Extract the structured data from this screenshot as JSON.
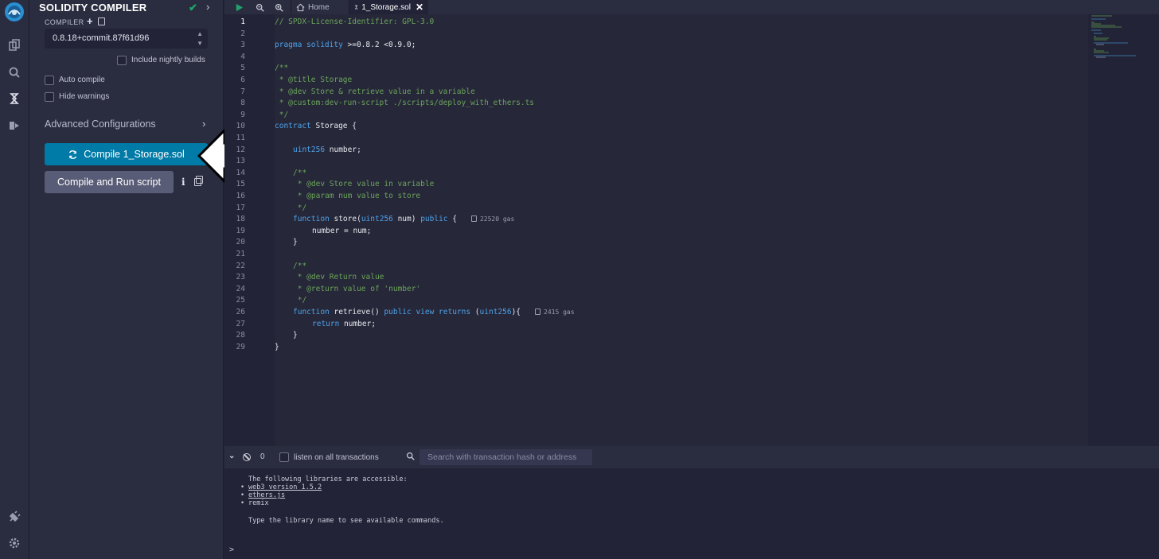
{
  "panel": {
    "title": "SOLIDITY COMPILER",
    "compiler_label": "COMPILER",
    "version_selected": "0.8.18+commit.87f61d96",
    "nightly_label": "Include nightly builds",
    "auto_compile_label": "Auto compile",
    "hide_warnings_label": "Hide warnings",
    "advanced_label": "Advanced Configurations",
    "compile_label": "Compile 1_Storage.sol",
    "run_script_label": "Compile and Run script"
  },
  "tabs": {
    "home": "Home",
    "active": "1_Storage.sol"
  },
  "editor": {
    "line_numbers": [
      "1",
      "2",
      "3",
      "4",
      "5",
      "6",
      "7",
      "8",
      "9",
      "10",
      "11",
      "12",
      "13",
      "14",
      "15",
      "16",
      "17",
      "18",
      "19",
      "20",
      "21",
      "22",
      "23",
      "24",
      "25",
      "26",
      "27",
      "28",
      "29"
    ],
    "lines": {
      "l1": "// SPDX-License-Identifier: GPL-3.0",
      "l3_kw": "pragma solidity",
      "l3_rest": " >=0.8.2 <0.9.0;",
      "l5": "/**",
      "l6": " * @title Storage",
      "l7": " * @dev Store & retrieve value in a variable",
      "l8": " * @custom:dev-run-script ./scripts/deploy_with_ethers.ts",
      "l9": " */",
      "l10_kw": "contract",
      "l10_rest": " Storage {",
      "l12_type": "uint256",
      "l12_rest": " number;",
      "l14": "/**",
      "l15": " * @dev Store value in variable",
      "l16": " * @param num value to store",
      "l17": " */",
      "l18_kw": "function",
      "l18_name": " store(",
      "l18_type": "uint256",
      "l18_mid": " num) ",
      "l18_kw2": "public",
      "l18_end": " {",
      "l18_gas": "22520 gas",
      "l19": "number = num;",
      "l20": "}",
      "l22": "/**",
      "l23": " * @dev Return value",
      "l24": " * @return value of 'number'",
      "l25": " */",
      "l26_kw": "function",
      "l26_name": " retrieve() ",
      "l26_kw2": "public view returns",
      "l26_p1": " (",
      "l26_type": "uint256",
      "l26_end": "){",
      "l26_gas": "2415 gas",
      "l27_kw": "return",
      "l27_rest": " number;",
      "l28": "}",
      "l29": "}"
    }
  },
  "terminal": {
    "count": "0",
    "listen_label": "listen on all transactions",
    "search_placeholder": "Search with transaction hash or address",
    "intro": "The following libraries are accessible:",
    "libs": [
      "web3 version 1.5.2",
      "ethers.js",
      "remix"
    ],
    "hint": "Type the library name to see available commands.",
    "prompt": ">"
  },
  "colors": {
    "accent": "#007aa6",
    "success": "#1ea56b",
    "comment": "#6ba55a",
    "keyword": "#4ea2e8"
  }
}
